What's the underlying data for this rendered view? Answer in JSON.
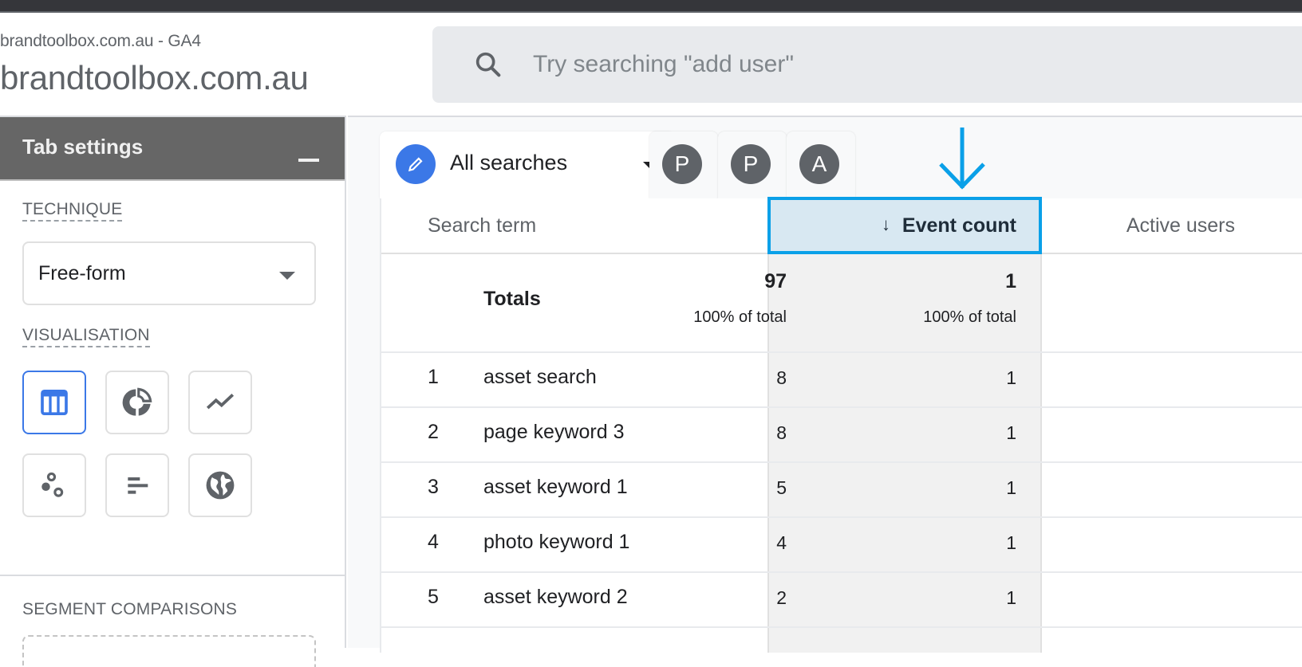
{
  "header": {
    "account_sub": "brandtoolbox.com.au - GA4",
    "account_title": "brandtoolbox.com.au",
    "search_placeholder": "Try searching \"add user\"",
    "search_icon": "search-icon"
  },
  "sidebar": {
    "title": "Tab settings",
    "collapse_icon": "minimize-icon",
    "technique_label": "TECHNIQUE",
    "technique_value": "Free-form",
    "visualisation_label": "VISUALISATION",
    "visualisations": [
      {
        "name": "table",
        "icon": "table-icon",
        "selected": true
      },
      {
        "name": "donut",
        "icon": "donut-chart-icon",
        "selected": false
      },
      {
        "name": "line",
        "icon": "line-chart-icon",
        "selected": false
      },
      {
        "name": "scatter",
        "icon": "scatter-plot-icon",
        "selected": false
      },
      {
        "name": "bar",
        "icon": "bar-chart-icon",
        "selected": false
      },
      {
        "name": "geo",
        "icon": "globe-icon",
        "selected": false
      }
    ],
    "segment_label": "SEGMENT COMPARISONS"
  },
  "tabs": {
    "active_label": "All searches",
    "active_icon": "pencil-icon",
    "compare_badges": [
      "P",
      "P",
      "A"
    ]
  },
  "table": {
    "columns": {
      "search_term": "Search term",
      "event_count": "Event count",
      "active_users": "Active users",
      "sort_arrow": "↓"
    },
    "totals": {
      "label": "Totals",
      "event_count": "97",
      "event_count_pct": "100% of total",
      "active_users": "1",
      "active_users_pct": "100% of total"
    },
    "rows": [
      {
        "idx": "1",
        "term": "asset search",
        "event_count": "8",
        "active_users": "1"
      },
      {
        "idx": "2",
        "term": "page keyword 3",
        "event_count": "8",
        "active_users": "1"
      },
      {
        "idx": "3",
        "term": "asset keyword 1",
        "event_count": "5",
        "active_users": "1"
      },
      {
        "idx": "4",
        "term": "photo keyword 1",
        "event_count": "4",
        "active_users": "1"
      },
      {
        "idx": "5",
        "term": "asset keyword 2",
        "event_count": "2",
        "active_users": "1"
      }
    ]
  },
  "colors": {
    "accent_blue": "#3b78e7",
    "annotation_blue": "#0aa0e8",
    "sidebar_header": "#666666"
  }
}
